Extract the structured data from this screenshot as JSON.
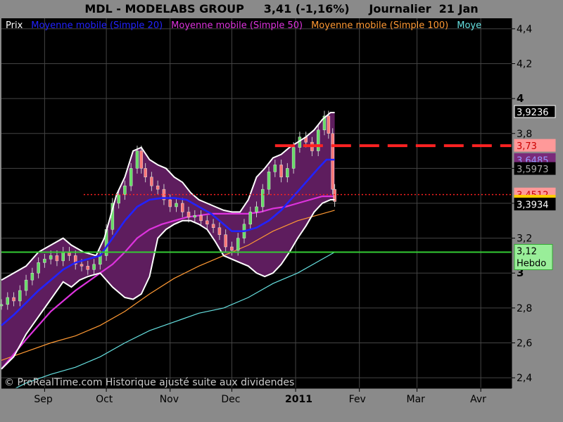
{
  "header": {
    "title": "MDL - MODELABS GROUP     3,41 (-1,16%)     Journalier  21 Jan"
  },
  "legend": [
    {
      "label": "Prix",
      "color": "#ffffff"
    },
    {
      "label": "Moyenne mobile (Simple 20)",
      "color": "#2222ff"
    },
    {
      "label": "Moyenne mobile (Simple 50)",
      "color": "#dd33dd"
    },
    {
      "label": "Moyenne mobile (Simple 100)",
      "color": "#ff9933"
    },
    {
      "label": "Moye",
      "color": "#66e0e0"
    }
  ],
  "copyright": "© ProRealTime.com Historique ajusté suite aux dividendes",
  "colors": {
    "background": "#000000",
    "bollinger_fill": "#5e1d5e",
    "bollinger_band": "#ffffff",
    "sma20": "#2222ff",
    "sma50": "#dd33dd",
    "sma100": "#ff9933",
    "sma200": "#66e0e0",
    "support": "#33cc33",
    "resistance": "#ff2222"
  },
  "chart_data": {
    "type": "line",
    "y_range": [
      2.34,
      4.46
    ],
    "y_ticks": [
      {
        "value": 2.4,
        "label": "2,4"
      },
      {
        "value": 2.6,
        "label": "2,6"
      },
      {
        "value": 2.8,
        "label": "2,8"
      },
      {
        "value": 3.0,
        "label": "3"
      },
      {
        "value": 3.2,
        "label": "3,2"
      },
      {
        "value": 3.4,
        "label": "3,4"
      },
      {
        "value": 3.6,
        "label": "3,6"
      },
      {
        "value": 3.8,
        "label": "3,8"
      },
      {
        "value": 4.0,
        "label": "4"
      },
      {
        "value": 4.2,
        "label": "4,2"
      },
      {
        "value": 4.4,
        "label": "4,4"
      }
    ],
    "x_months": [
      {
        "label": "Sep",
        "day": 21
      },
      {
        "label": "Oct",
        "day": 51
      },
      {
        "label": "Nov",
        "day": 82
      },
      {
        "label": "Dec",
        "day": 112
      },
      {
        "label": "2011",
        "day": 143,
        "bold": true
      },
      {
        "label": "Fev",
        "day": 174
      },
      {
        "label": "Mar",
        "day": 202
      },
      {
        "label": "Avr",
        "day": 233
      }
    ],
    "x_range_days": [
      0,
      248
    ],
    "price": [
      [
        0,
        2.82
      ],
      [
        3,
        2.86
      ],
      [
        6,
        2.84
      ],
      [
        9,
        2.9
      ],
      [
        12,
        2.96
      ],
      [
        15,
        3.0
      ],
      [
        18,
        3.06
      ],
      [
        21,
        3.08
      ],
      [
        24,
        3.1
      ],
      [
        27,
        3.07
      ],
      [
        30,
        3.12
      ],
      [
        33,
        3.1
      ],
      [
        36,
        3.05
      ],
      [
        39,
        3.04
      ],
      [
        42,
        3.02
      ],
      [
        45,
        3.05
      ],
      [
        48,
        3.1
      ],
      [
        51,
        3.25
      ],
      [
        54,
        3.4
      ],
      [
        57,
        3.45
      ],
      [
        60,
        3.5
      ],
      [
        63,
        3.6
      ],
      [
        66,
        3.7
      ],
      [
        68,
        3.6
      ],
      [
        70,
        3.55
      ],
      [
        73,
        3.5
      ],
      [
        76,
        3.48
      ],
      [
        79,
        3.42
      ],
      [
        82,
        3.38
      ],
      [
        85,
        3.4
      ],
      [
        88,
        3.35
      ],
      [
        91,
        3.32
      ],
      [
        94,
        3.33
      ],
      [
        97,
        3.3
      ],
      [
        100,
        3.28
      ],
      [
        103,
        3.26
      ],
      [
        106,
        3.22
      ],
      [
        109,
        3.15
      ],
      [
        112,
        3.13
      ],
      [
        115,
        3.2
      ],
      [
        118,
        3.28
      ],
      [
        121,
        3.35
      ],
      [
        124,
        3.38
      ],
      [
        127,
        3.48
      ],
      [
        130,
        3.58
      ],
      [
        133,
        3.62
      ],
      [
        136,
        3.55
      ],
      [
        139,
        3.6
      ],
      [
        142,
        3.72
      ],
      [
        145,
        3.78
      ],
      [
        148,
        3.75
      ],
      [
        151,
        3.7
      ],
      [
        154,
        3.82
      ],
      [
        157,
        3.9
      ],
      [
        159,
        3.8
      ],
      [
        161,
        3.48
      ],
      [
        162,
        3.41
      ]
    ],
    "series": [
      {
        "name": "Moyenne mobile (Simple 20)",
        "key": "sma20",
        "width": 2.6,
        "points": [
          [
            0,
            2.7
          ],
          [
            6,
            2.76
          ],
          [
            12,
            2.83
          ],
          [
            18,
            2.9
          ],
          [
            24,
            2.96
          ],
          [
            30,
            3.02
          ],
          [
            36,
            3.06
          ],
          [
            42,
            3.08
          ],
          [
            48,
            3.1
          ],
          [
            54,
            3.2
          ],
          [
            60,
            3.3
          ],
          [
            66,
            3.38
          ],
          [
            72,
            3.42
          ],
          [
            78,
            3.43
          ],
          [
            84,
            3.43
          ],
          [
            90,
            3.42
          ],
          [
            96,
            3.38
          ],
          [
            102,
            3.34
          ],
          [
            108,
            3.28
          ],
          [
            112,
            3.24
          ],
          [
            118,
            3.24
          ],
          [
            124,
            3.26
          ],
          [
            130,
            3.3
          ],
          [
            136,
            3.36
          ],
          [
            142,
            3.44
          ],
          [
            148,
            3.52
          ],
          [
            154,
            3.6
          ],
          [
            158,
            3.65
          ],
          [
            162,
            3.65
          ]
        ]
      },
      {
        "name": "Moyenne mobile (Simple 50)",
        "key": "sma50",
        "width": 2.2,
        "points": [
          [
            0,
            2.45
          ],
          [
            12,
            2.62
          ],
          [
            24,
            2.78
          ],
          [
            36,
            2.9
          ],
          [
            42,
            2.95
          ],
          [
            48,
            3.0
          ],
          [
            54,
            3.05
          ],
          [
            60,
            3.12
          ],
          [
            66,
            3.2
          ],
          [
            72,
            3.25
          ],
          [
            78,
            3.28
          ],
          [
            84,
            3.3
          ],
          [
            90,
            3.32
          ],
          [
            96,
            3.33
          ],
          [
            102,
            3.34
          ],
          [
            108,
            3.34
          ],
          [
            114,
            3.34
          ],
          [
            120,
            3.34
          ],
          [
            126,
            3.35
          ],
          [
            132,
            3.37
          ],
          [
            138,
            3.38
          ],
          [
            144,
            3.4
          ],
          [
            150,
            3.42
          ],
          [
            156,
            3.44
          ],
          [
            162,
            3.44
          ]
        ]
      },
      {
        "name": "Moyenne mobile (Simple 100)",
        "key": "sma100",
        "width": 1.2,
        "points": [
          [
            0,
            2.5
          ],
          [
            12,
            2.55
          ],
          [
            24,
            2.6
          ],
          [
            36,
            2.64
          ],
          [
            48,
            2.7
          ],
          [
            60,
            2.78
          ],
          [
            72,
            2.88
          ],
          [
            84,
            2.97
          ],
          [
            96,
            3.04
          ],
          [
            108,
            3.1
          ],
          [
            120,
            3.16
          ],
          [
            132,
            3.24
          ],
          [
            144,
            3.3
          ],
          [
            156,
            3.34
          ],
          [
            162,
            3.36
          ]
        ]
      },
      {
        "name": "Moye",
        "key": "sma200",
        "width": 1.2,
        "points": [
          [
            0,
            2.3
          ],
          [
            12,
            2.37
          ],
          [
            24,
            2.42
          ],
          [
            36,
            2.46
          ],
          [
            48,
            2.52
          ],
          [
            60,
            2.6
          ],
          [
            72,
            2.67
          ],
          [
            84,
            2.72
          ],
          [
            96,
            2.77
          ],
          [
            108,
            2.8
          ],
          [
            120,
            2.86
          ],
          [
            132,
            2.94
          ],
          [
            144,
            3.0
          ],
          [
            156,
            3.08
          ],
          [
            162,
            3.12
          ]
        ]
      }
    ],
    "bollinger": {
      "upper": [
        [
          0,
          2.96
        ],
        [
          6,
          3.0
        ],
        [
          12,
          3.04
        ],
        [
          18,
          3.12
        ],
        [
          24,
          3.16
        ],
        [
          30,
          3.2
        ],
        [
          34,
          3.16
        ],
        [
          40,
          3.12
        ],
        [
          46,
          3.1
        ],
        [
          50,
          3.2
        ],
        [
          56,
          3.45
        ],
        [
          60,
          3.55
        ],
        [
          64,
          3.7
        ],
        [
          68,
          3.72
        ],
        [
          72,
          3.65
        ],
        [
          76,
          3.62
        ],
        [
          80,
          3.6
        ],
        [
          84,
          3.55
        ],
        [
          88,
          3.52
        ],
        [
          92,
          3.46
        ],
        [
          96,
          3.42
        ],
        [
          100,
          3.4
        ],
        [
          104,
          3.38
        ],
        [
          108,
          3.36
        ],
        [
          112,
          3.35
        ],
        [
          116,
          3.35
        ],
        [
          120,
          3.42
        ],
        [
          124,
          3.55
        ],
        [
          128,
          3.6
        ],
        [
          132,
          3.66
        ],
        [
          136,
          3.68
        ],
        [
          140,
          3.72
        ],
        [
          144,
          3.75
        ],
        [
          148,
          3.78
        ],
        [
          152,
          3.82
        ],
        [
          156,
          3.88
        ],
        [
          160,
          3.92
        ],
        [
          162,
          3.92
        ]
      ],
      "lower": [
        [
          0,
          2.45
        ],
        [
          6,
          2.52
        ],
        [
          12,
          2.65
        ],
        [
          18,
          2.75
        ],
        [
          24,
          2.85
        ],
        [
          30,
          2.95
        ],
        [
          34,
          2.92
        ],
        [
          38,
          2.96
        ],
        [
          42,
          2.98
        ],
        [
          48,
          3.0
        ],
        [
          54,
          2.92
        ],
        [
          60,
          2.86
        ],
        [
          64,
          2.85
        ],
        [
          68,
          2.88
        ],
        [
          72,
          2.98
        ],
        [
          76,
          3.2
        ],
        [
          80,
          3.25
        ],
        [
          84,
          3.28
        ],
        [
          88,
          3.3
        ],
        [
          92,
          3.3
        ],
        [
          96,
          3.28
        ],
        [
          100,
          3.25
        ],
        [
          104,
          3.18
        ],
        [
          108,
          3.1
        ],
        [
          112,
          3.08
        ],
        [
          116,
          3.06
        ],
        [
          120,
          3.04
        ],
        [
          124,
          3.0
        ],
        [
          128,
          2.98
        ],
        [
          132,
          3.0
        ],
        [
          136,
          3.05
        ],
        [
          140,
          3.12
        ],
        [
          144,
          3.2
        ],
        [
          148,
          3.27
        ],
        [
          152,
          3.35
        ],
        [
          156,
          3.4
        ],
        [
          160,
          3.42
        ],
        [
          162,
          3.42
        ]
      ]
    },
    "resistance_level": {
      "value": 3.73,
      "start_day": 133
    },
    "dotted_level": {
      "value": 3.45,
      "start_day": 40
    },
    "support_level": {
      "value": 3.12,
      "label": "3,12",
      "sublabel": "Hebdo"
    },
    "right_labels": [
      {
        "value": 3.9236,
        "label": "3,9236",
        "bg": "#000000",
        "fg": "#ffffff",
        "border": "#ffffff"
      },
      {
        "value": 3.73,
        "label": "3,73",
        "bg": "#ff9999",
        "fg": "#cc0000",
        "border": "#ff9999"
      },
      {
        "value": 3.6485,
        "label": "3,6485",
        "bg": "#7a2a7a",
        "fg": "#9999ff",
        "border": "#7a2a7a"
      },
      {
        "value": 3.5973,
        "label": "3,5973",
        "bg": "#000000",
        "fg": "#aaaaaa",
        "border": "#000000"
      },
      {
        "value": 3.4512,
        "label": "3,4512",
        "bg": "#ff9999",
        "fg": "#cc0000",
        "border": "#ff9999"
      },
      {
        "value": 3.41,
        "label": "3,41",
        "bg": "#ffcc00",
        "fg": "#000000",
        "border": "#ffcc00"
      },
      {
        "value": 3.3934,
        "label": "3,3934",
        "bg": "#000000",
        "fg": "#ffffff",
        "border": "#000000"
      }
    ]
  }
}
